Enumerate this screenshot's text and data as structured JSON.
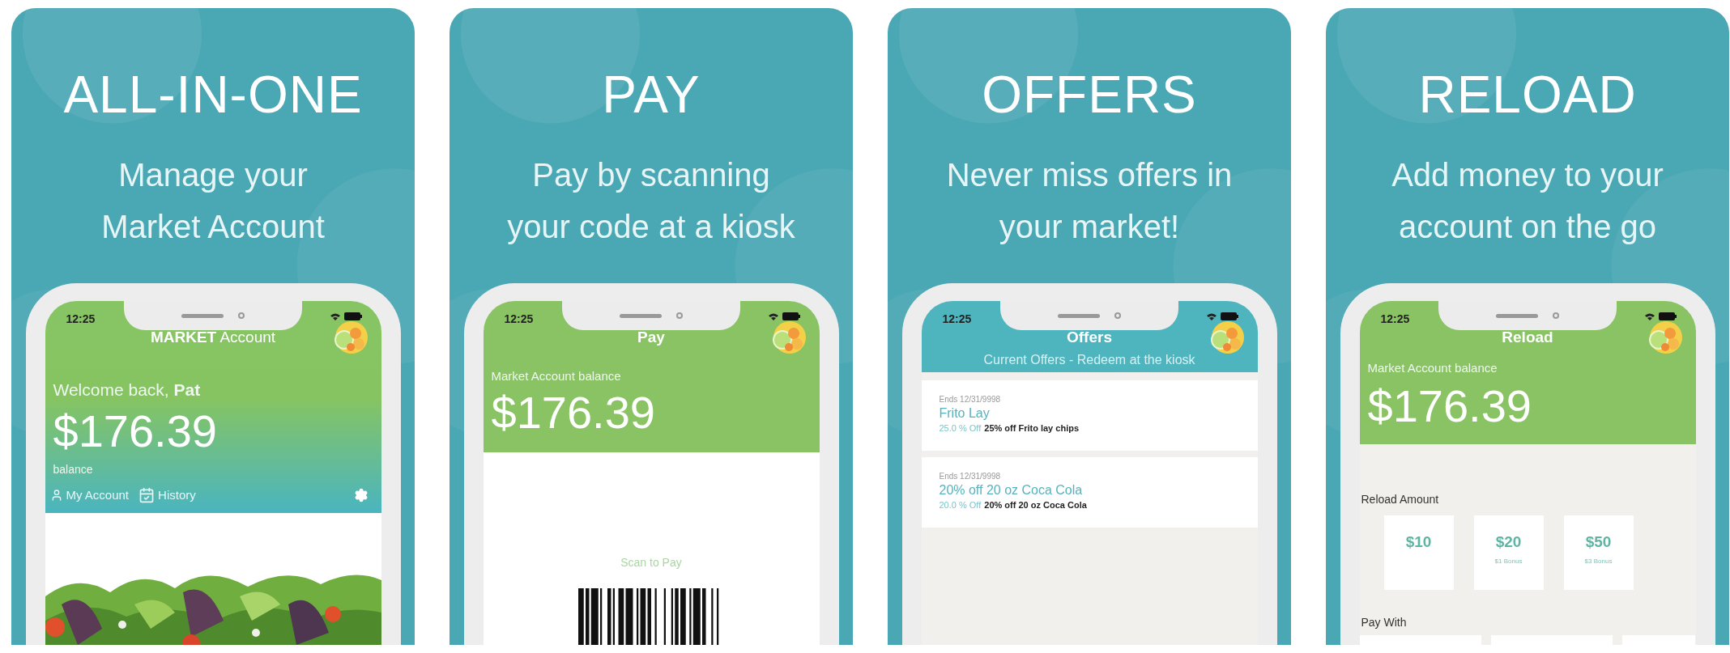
{
  "panels": [
    {
      "kind": "account",
      "heading": "ALL-IN-ONE",
      "subtitle_lines": [
        "Manage your",
        "Market Account"
      ],
      "phone": {
        "time": "12:25",
        "title": "**MARKET** Account",
        "greeting": "Welcome back, **Pat**",
        "balance": "$176.39",
        "balance_label": "balance",
        "links": [
          {
            "kind": "account",
            "label": "My Account"
          },
          {
            "kind": "history",
            "label": "History"
          }
        ]
      }
    },
    {
      "kind": "pay",
      "heading": "PAY",
      "subtitle_lines": [
        "Pay by scanning",
        "your code at a kiosk"
      ],
      "phone": {
        "time": "12:25",
        "title": "Pay",
        "balance_label": "Market Account balance",
        "balance": "$176.39",
        "scan_label": "Scan to Pay"
      }
    },
    {
      "kind": "offers",
      "heading": "OFFERS",
      "subtitle_lines": [
        "Never miss offers in",
        "your market!"
      ],
      "phone": {
        "time": "12:25",
        "title": "Offers",
        "subtitle": "Current Offers - Redeem at the kiosk",
        "offers": [
          {
            "ends": "Ends 12/31/9998",
            "name": "Frito Lay",
            "discount": "25.0 % Off",
            "description": "25% off Frito lay chips"
          },
          {
            "ends": "Ends 12/31/9998",
            "name": "20% off 20 oz Coca Cola",
            "discount": "20.0 % Off",
            "description": "20% off 20 oz Coca Cola"
          }
        ]
      }
    },
    {
      "kind": "reload",
      "heading": "RELOAD",
      "subtitle_lines": [
        "Add money to your",
        "account on the go"
      ],
      "phone": {
        "time": "12:25",
        "title": "Reload",
        "balance_label": "Market Account balance",
        "balance": "$176.39",
        "amount_label": "Reload Amount",
        "amounts": [
          {
            "amount": "$10"
          },
          {
            "amount": "$20",
            "bonus": "$1 Bonus"
          },
          {
            "amount": "$50",
            "bonus": "$3 Bonus"
          }
        ],
        "pay_with_label": "Pay With"
      }
    }
  ]
}
